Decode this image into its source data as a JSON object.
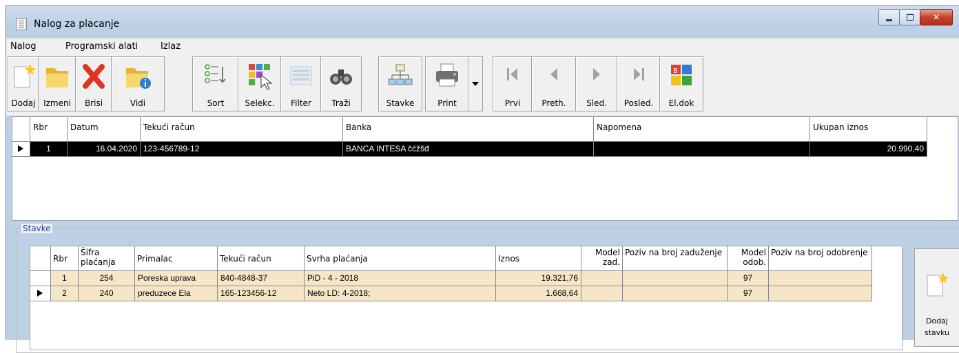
{
  "window": {
    "title": "Nalog za placanje",
    "controls": [
      "minimize",
      "maximize",
      "close"
    ]
  },
  "menu": [
    "Nalog",
    "Programski alati",
    "Izlaz"
  ],
  "toolbar": {
    "dodaj": "Dodaj",
    "izmeni": "Izmeni",
    "brisi": "Brisi",
    "vidi": "Vidi",
    "sort": "Sort",
    "selekc": "Selekc.",
    "filter": "Filter",
    "trazi": "Traži",
    "stavke": "Stavke",
    "print": "Print",
    "prvi": "Prvi",
    "preth": "Preth.",
    "sled": "Sled.",
    "posled": "Posled.",
    "eldok": "El.dok"
  },
  "main_grid": {
    "headers": [
      "Rbr",
      "Datum",
      "Tekući račun",
      "Banka",
      "Napomena",
      "Ukupan iznos"
    ],
    "rows": [
      {
        "rbr": "1",
        "datum": "16.04.2020",
        "racun": "123-456789-12",
        "banka": "BANCA INTESA čćžšđ",
        "napomena": "",
        "iznos": "20.990,40"
      }
    ]
  },
  "stavke": {
    "title": "Stavke",
    "headers": {
      "rbr": "Rbr",
      "sifra": "Šifra plaćanja",
      "primalac": "Primalac",
      "racun": "Tekući račun",
      "svrha": "Svrha plaćanja",
      "iznos": "Iznos",
      "model_zad": "Model zad.",
      "poziv_zad": "Poziv na broj zaduženje",
      "model_odob": "Model odob.",
      "poziv_odob": "Poziv na broj odobrenje"
    },
    "rows": [
      {
        "rbr": "1",
        "sifra": "254",
        "primalac": "Poreska uprava",
        "racun": "840-4848-37",
        "svrha": "PiD - 4 - 2018",
        "iznos": "19.321,76",
        "model_zad": "",
        "poziv_zad": "",
        "model_odob": "97",
        "poziv_odob": ""
      },
      {
        "rbr": "2",
        "sifra": "240",
        "primalac": "preduzece Ela",
        "racun": "165-123456-12",
        "svrha": "Neto LD: 4-2018;",
        "iznos": "1.668,64",
        "model_zad": "",
        "poziv_zad": "",
        "model_odob": "97",
        "poziv_odob": ""
      }
    ],
    "add_button": "Dodaj stavku"
  }
}
